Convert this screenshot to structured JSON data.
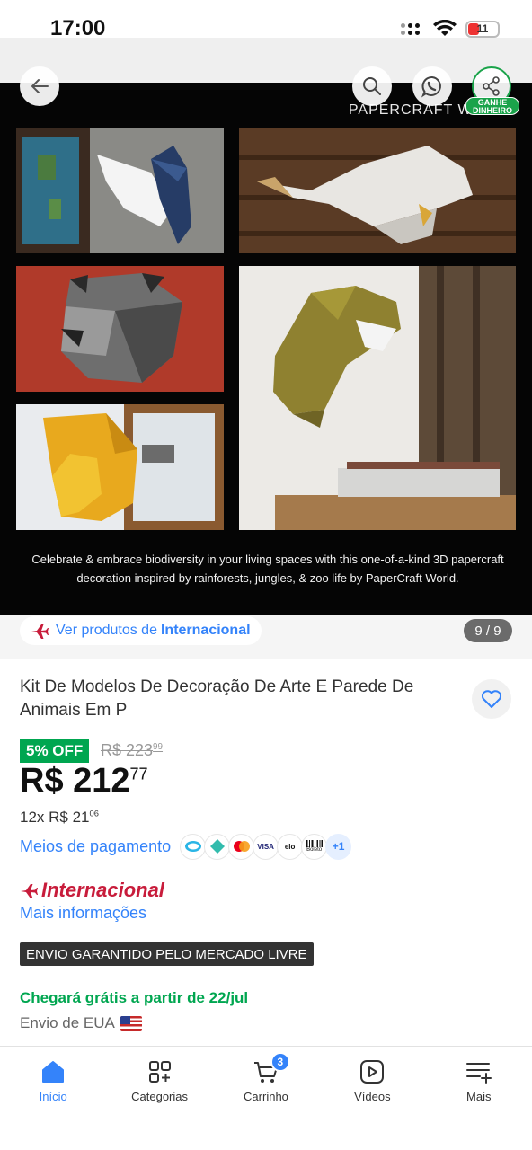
{
  "status_bar": {
    "time": "17:00",
    "battery_level": "11"
  },
  "header": {
    "back_icon": "arrow-left-icon",
    "search_icon": "search-icon",
    "whatsapp_icon": "whatsapp-icon",
    "share_icon": "share-icon",
    "share_badge_line1": "GANHE",
    "share_badge_line2": "DINHEIRO"
  },
  "gallery": {
    "brand": "PAPERCRAFT WORLD",
    "caption": "Celebrate & embrace biodiversity in your living spaces with this one-of-a-kind 3D papercraft decoration inspired by rainforests, jungles, & zoo life by PaperCraft World.",
    "counter": "9 / 9"
  },
  "seller_chip": {
    "prefix": "Ver produtos de",
    "name": "Internacional"
  },
  "product": {
    "title": "Kit De Modelos De Decoração De Arte E Parede De Animais Em P",
    "discount": "5% OFF",
    "old_price_int": "R$ 223",
    "old_price_cents": "99",
    "price_int": "R$ 212",
    "price_cents": "77",
    "installments_int": "12x R$ 21",
    "installments_cents": "06",
    "payment_label": "Meios de pagamento",
    "payment_methods": [
      "mercado-pago",
      "pix",
      "mastercard",
      "VISA",
      "elo",
      "Boleto"
    ],
    "payment_more": "+1",
    "intl_label": "Internacional",
    "more_info": "Mais informações",
    "guarantee": "ENVIO GARANTIDO PELO MERCADO LIVRE",
    "arrival": "Chegará grátis a partir de 22/jul",
    "origin": "Envio de EUA"
  },
  "bottom_nav": [
    {
      "label": "Início",
      "icon": "home-icon"
    },
    {
      "label": "Categorias",
      "icon": "categories-icon"
    },
    {
      "label": "Carrinho",
      "icon": "cart-icon",
      "badge": "3"
    },
    {
      "label": "Vídeos",
      "icon": "video-icon"
    },
    {
      "label": "Mais",
      "icon": "more-icon"
    }
  ],
  "colors": {
    "accent": "#3483fa",
    "green": "#00a650",
    "intl_red": "#c81c3b"
  }
}
